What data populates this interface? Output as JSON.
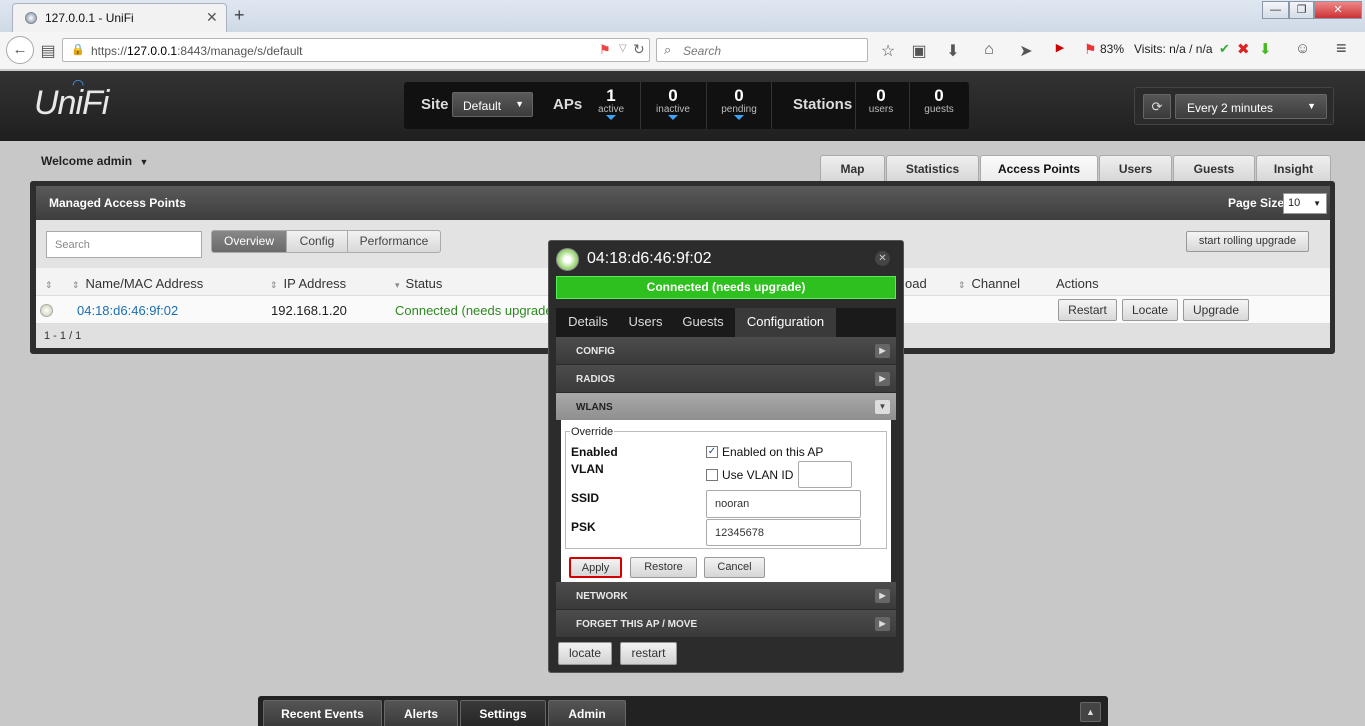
{
  "browser": {
    "tab_title": "127.0.0.1 - UniFi",
    "url_prefix": "https://",
    "url_host": "127.0.0.1",
    "url_rest": ":8443/manage/s/default",
    "search_placeholder": "Search",
    "ext_percent": "83%",
    "ext_visits": "Visits: n/a / n/a"
  },
  "header": {
    "logo": "UniFi",
    "site_label": "Site",
    "site_value": "Default",
    "aps_label": "APs",
    "active_count": "1",
    "active_label": "active",
    "inactive_count": "0",
    "inactive_label": "inactive",
    "pending_count": "0",
    "pending_label": "pending",
    "stations_label": "Stations",
    "users_count": "0",
    "users_label": "users",
    "guests_count": "0",
    "guests_label": "guests",
    "refresh_value": "Every 2 minutes"
  },
  "welcome": "Welcome admin",
  "nav_tabs": [
    "Map",
    "Statistics",
    "Access Points",
    "Users",
    "Guests",
    "Insight"
  ],
  "panel": {
    "title": "Managed Access Points",
    "page_size_label": "Page Size",
    "page_size_value": "10",
    "search_placeholder": "Search",
    "views": [
      "Overview",
      "Config",
      "Performance"
    ],
    "rolling_upgrade": "start rolling upgrade",
    "columns": [
      "Name/MAC Address",
      "IP Address",
      "Status",
      "oad",
      "Channel",
      "Actions"
    ],
    "row": {
      "name": "04:18:d6:46:9f:02",
      "ip": "192.168.1.20",
      "status": "Connected (needs upgrade"
    },
    "row_actions": [
      "Restart",
      "Locate",
      "Upgrade"
    ],
    "pagination": "1 - 1 / 1"
  },
  "popup": {
    "title": "04:18:d6:46:9f:02",
    "status": "Connected (needs upgrade)",
    "tabs": [
      "Details",
      "Users",
      "Guests",
      "Configuration"
    ],
    "sections": {
      "config": "CONFIG",
      "radios": "RADIOS",
      "wlans": "WLANS",
      "network": "NETWORK",
      "forget": "FORGET THIS AP / MOVE"
    },
    "override_legend": "Override",
    "enabled_label": "Enabled",
    "enabled_text": "Enabled on this AP",
    "vlan_label": "VLAN",
    "vlan_text": "Use VLAN ID",
    "ssid_label": "SSID",
    "ssid_value": "nooran",
    "psk_label": "PSK",
    "psk_value": "12345678",
    "apply": "Apply",
    "restore": "Restore",
    "cancel": "Cancel",
    "locate": "locate",
    "restart": "restart"
  },
  "bottom_tabs": [
    "Recent Events",
    "Alerts",
    "Settings",
    "Admin"
  ],
  "colors": {
    "connected_green": "#2ec01e",
    "link_blue": "#1a6fb5",
    "status_green": "#2d8a1f",
    "apply_highlight": "#d40000"
  }
}
